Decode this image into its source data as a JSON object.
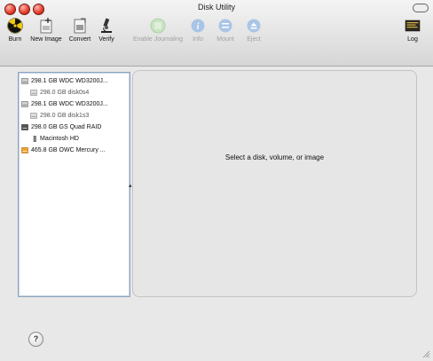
{
  "window": {
    "title": "Disk Utility"
  },
  "toolbar": {
    "items": [
      {
        "label": "Burn",
        "icon": "burn-icon",
        "enabled": true
      },
      {
        "label": "New Image",
        "icon": "new-image-icon",
        "enabled": true
      },
      {
        "label": "Convert",
        "icon": "convert-icon",
        "enabled": true
      },
      {
        "label": "Verify",
        "icon": "verify-icon",
        "enabled": true
      },
      {
        "label": "Enable Journaling",
        "icon": "enable-journaling-icon",
        "enabled": false
      },
      {
        "label": "Info",
        "icon": "info-icon",
        "enabled": false
      },
      {
        "label": "Mount",
        "icon": "mount-icon",
        "enabled": false
      },
      {
        "label": "Eject",
        "icon": "eject-icon",
        "enabled": false
      },
      {
        "label": "Log",
        "icon": "log-icon",
        "enabled": true
      }
    ]
  },
  "sidebar": {
    "items": [
      {
        "label": "298.1 GB WDC WD3200J...",
        "level": 0,
        "icon": "hard-disk-icon"
      },
      {
        "label": "298.0 GB disk0s4",
        "level": 1,
        "icon": "volume-icon"
      },
      {
        "label": "298.1 GB WDC WD3200J...",
        "level": 0,
        "icon": "hard-disk-icon"
      },
      {
        "label": "298.0 GB disk1s3",
        "level": 1,
        "icon": "volume-icon"
      },
      {
        "label": "298.0 GB GS Quad RAID",
        "level": 0,
        "icon": "raid-disk-icon"
      },
      {
        "label": "Macintosh HD",
        "level": 1,
        "icon": "macintosh-hd-icon"
      },
      {
        "label": "465.8 GB OWC Mercury ...",
        "level": 0,
        "icon": "external-disk-icon"
      }
    ]
  },
  "main": {
    "message": "Select a disk, volume, or image"
  },
  "help": {
    "label": "?"
  },
  "colors": {
    "disabled_text": "#a0a0a0",
    "sidebar_border": "#8ea5bf",
    "close_red": "#e33b2b"
  }
}
